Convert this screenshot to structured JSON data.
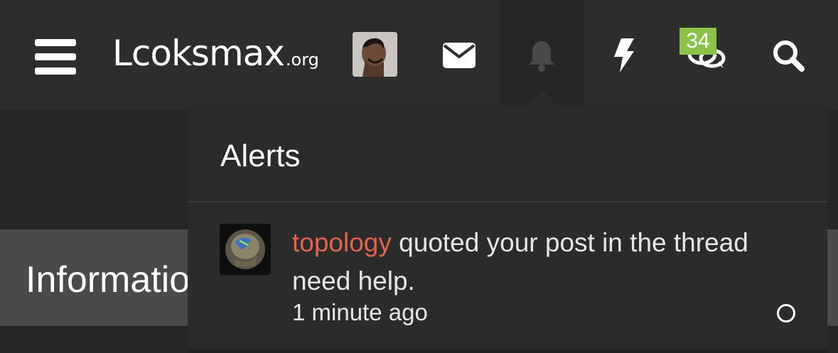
{
  "navbar": {
    "logo_main": "Lcoksmax",
    "logo_org": ".org",
    "chat_badge": "34"
  },
  "background": {
    "info_title": "Information"
  },
  "alerts": {
    "title": "Alerts",
    "items": [
      {
        "username": "topology",
        "message": " quoted your post in the thread need help.",
        "time": "1 minute ago"
      }
    ]
  },
  "colors": {
    "accent_username": "#e0654b",
    "badge": "#8bc34a",
    "nav_bg": "#2d2d2d"
  },
  "icons": [
    "menu-icon",
    "envelope-icon",
    "bell-icon",
    "bolt-icon",
    "chat-icon",
    "search-icon",
    "circle-icon"
  ]
}
